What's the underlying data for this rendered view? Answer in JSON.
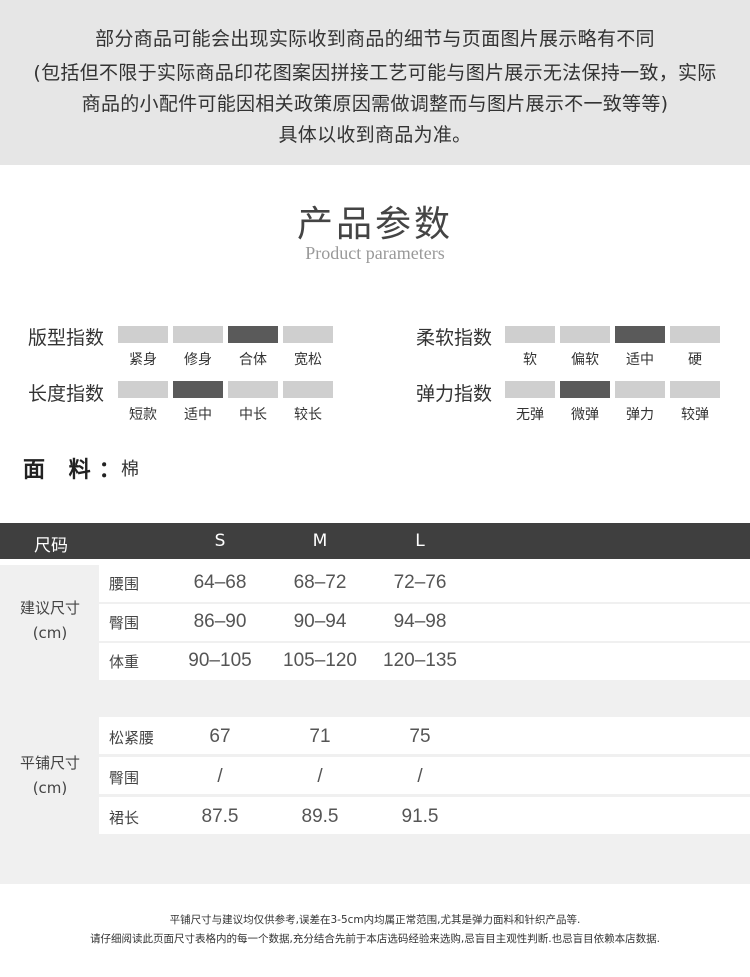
{
  "notice": {
    "line1": "部分商品可能会出现实际收到商品的细节与页面图片展示略有不同",
    "line2": "(包括但不限于实际商品印花图案因拼接工艺可能与图片展示无法保持一致，实际",
    "line3": "商品的小配件可能因相关政策原因需做调整而与图片展示不一致等等)",
    "line4": "具体以收到商品为准。"
  },
  "title": {
    "cn": "产品参数",
    "en": "Product parameters"
  },
  "indices": {
    "fit": {
      "label": "版型指数",
      "options": [
        "紧身",
        "修身",
        "合体",
        "宽松"
      ],
      "selected": "合体"
    },
    "softness": {
      "label": "柔软指数",
      "options": [
        "软",
        "偏软",
        "适中",
        "硬"
      ],
      "selected": "适中"
    },
    "length": {
      "label": "长度指数",
      "options": [
        "短款",
        "适中",
        "中长",
        "较长"
      ],
      "selected": "适中"
    },
    "elasticity": {
      "label": "弹力指数",
      "options": [
        "无弹",
        "微弹",
        "弹力",
        "较弹"
      ],
      "selected": "微弹"
    }
  },
  "fabric": {
    "label": "面 料：",
    "value": "棉"
  },
  "size_table": {
    "header": {
      "label": "尺码",
      "sizes": [
        "S",
        "M",
        "L"
      ]
    },
    "suggested": {
      "label_line1": "建议尺寸",
      "label_line2": "(cm)",
      "rows": [
        {
          "name": "腰围",
          "values": [
            "64–68",
            "68–72",
            "72–76"
          ]
        },
        {
          "name": "臀围",
          "values": [
            "86–90",
            "90–94",
            "94–98"
          ]
        },
        {
          "name": "体重",
          "values": [
            "90–105",
            "105–120",
            "120–135"
          ]
        }
      ]
    },
    "flat": {
      "label_line1": "平铺尺寸",
      "label_line2": "(cm)",
      "rows": [
        {
          "name": "松紧腰",
          "values": [
            "67",
            "71",
            "75"
          ]
        },
        {
          "name": "臀围",
          "values": [
            "/",
            "/",
            "/"
          ]
        },
        {
          "name": "裙长",
          "values": [
            "87.5",
            "89.5",
            "91.5"
          ]
        }
      ]
    }
  },
  "footer": {
    "line1": "平铺尺寸与建议均仅供参考,误差在3-5cm内均属正常范围,尤其是弹力面料和针织产品等.",
    "line2": "请仔细阅读此页面尺寸表格内的每一个数据,充分结合先前于本店选码经验来选购,忌盲目主观性判断.也忌盲目依赖本店数据."
  },
  "colors": {
    "selected_segment": "#5a5a5a",
    "unselected_segment": "#cfcfcf",
    "header_bg": "#3f3f3f",
    "notice_bg": "#e6e6e6"
  }
}
